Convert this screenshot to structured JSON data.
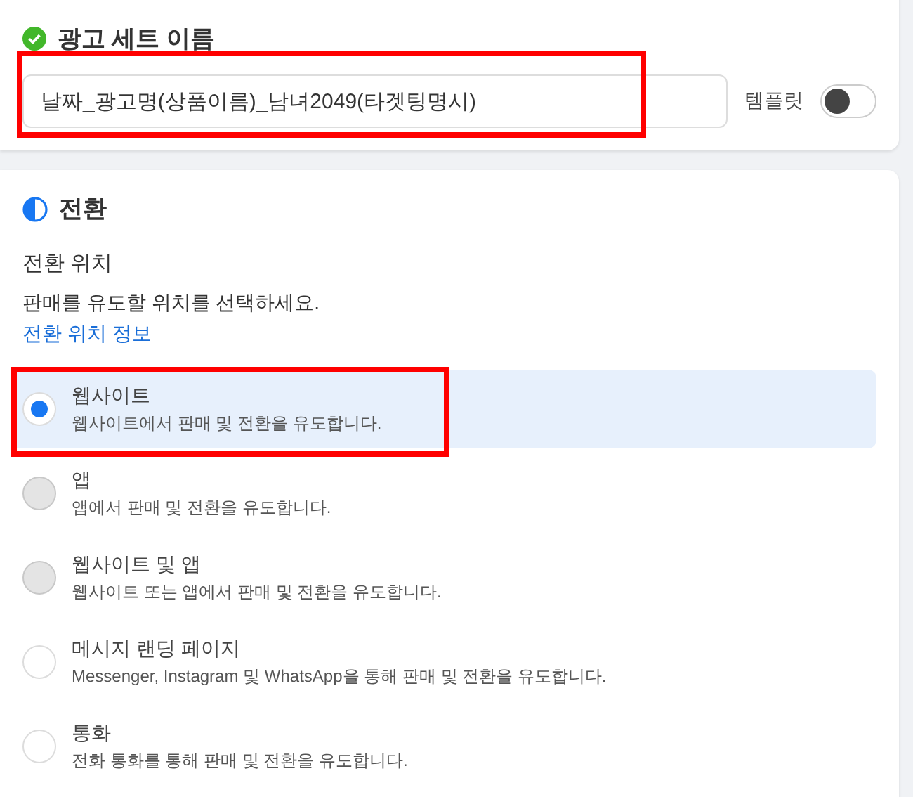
{
  "ad_set_name": {
    "complete": true,
    "title": "광고 세트 이름",
    "value": "날짜_광고명(상품이름)_남녀2049(타겟팅명시)",
    "highlighted": true,
    "template_label": "템플릿",
    "template_on": false
  },
  "conversion": {
    "title": "전환",
    "location_title": "전환 위치",
    "description": "판매를 유도할 위치를 선택하세요.",
    "info_link": "전환 위치 정보",
    "options": [
      {
        "label": "웹사이트",
        "description": "웹사이트에서 판매 및 전환을 유도합니다.",
        "selected": true,
        "disabled": false,
        "highlighted": true
      },
      {
        "label": "앱",
        "description": "앱에서 판매 및 전환을 유도합니다.",
        "selected": false,
        "disabled": true,
        "highlighted": false
      },
      {
        "label": "웹사이트 및 앱",
        "description": "웹사이트 또는 앱에서 판매 및 전환을 유도합니다.",
        "selected": false,
        "disabled": true,
        "highlighted": false
      },
      {
        "label": "메시지 랜딩 페이지",
        "description": "Messenger, Instagram 및 WhatsApp을 통해 판매 및 전환을 유도합니다.",
        "selected": false,
        "disabled": false,
        "highlighted": false
      },
      {
        "label": "통화",
        "description": "전화 통화를 통해 판매 및 전환을 유도합니다.",
        "selected": false,
        "disabled": false,
        "highlighted": false
      }
    ]
  }
}
